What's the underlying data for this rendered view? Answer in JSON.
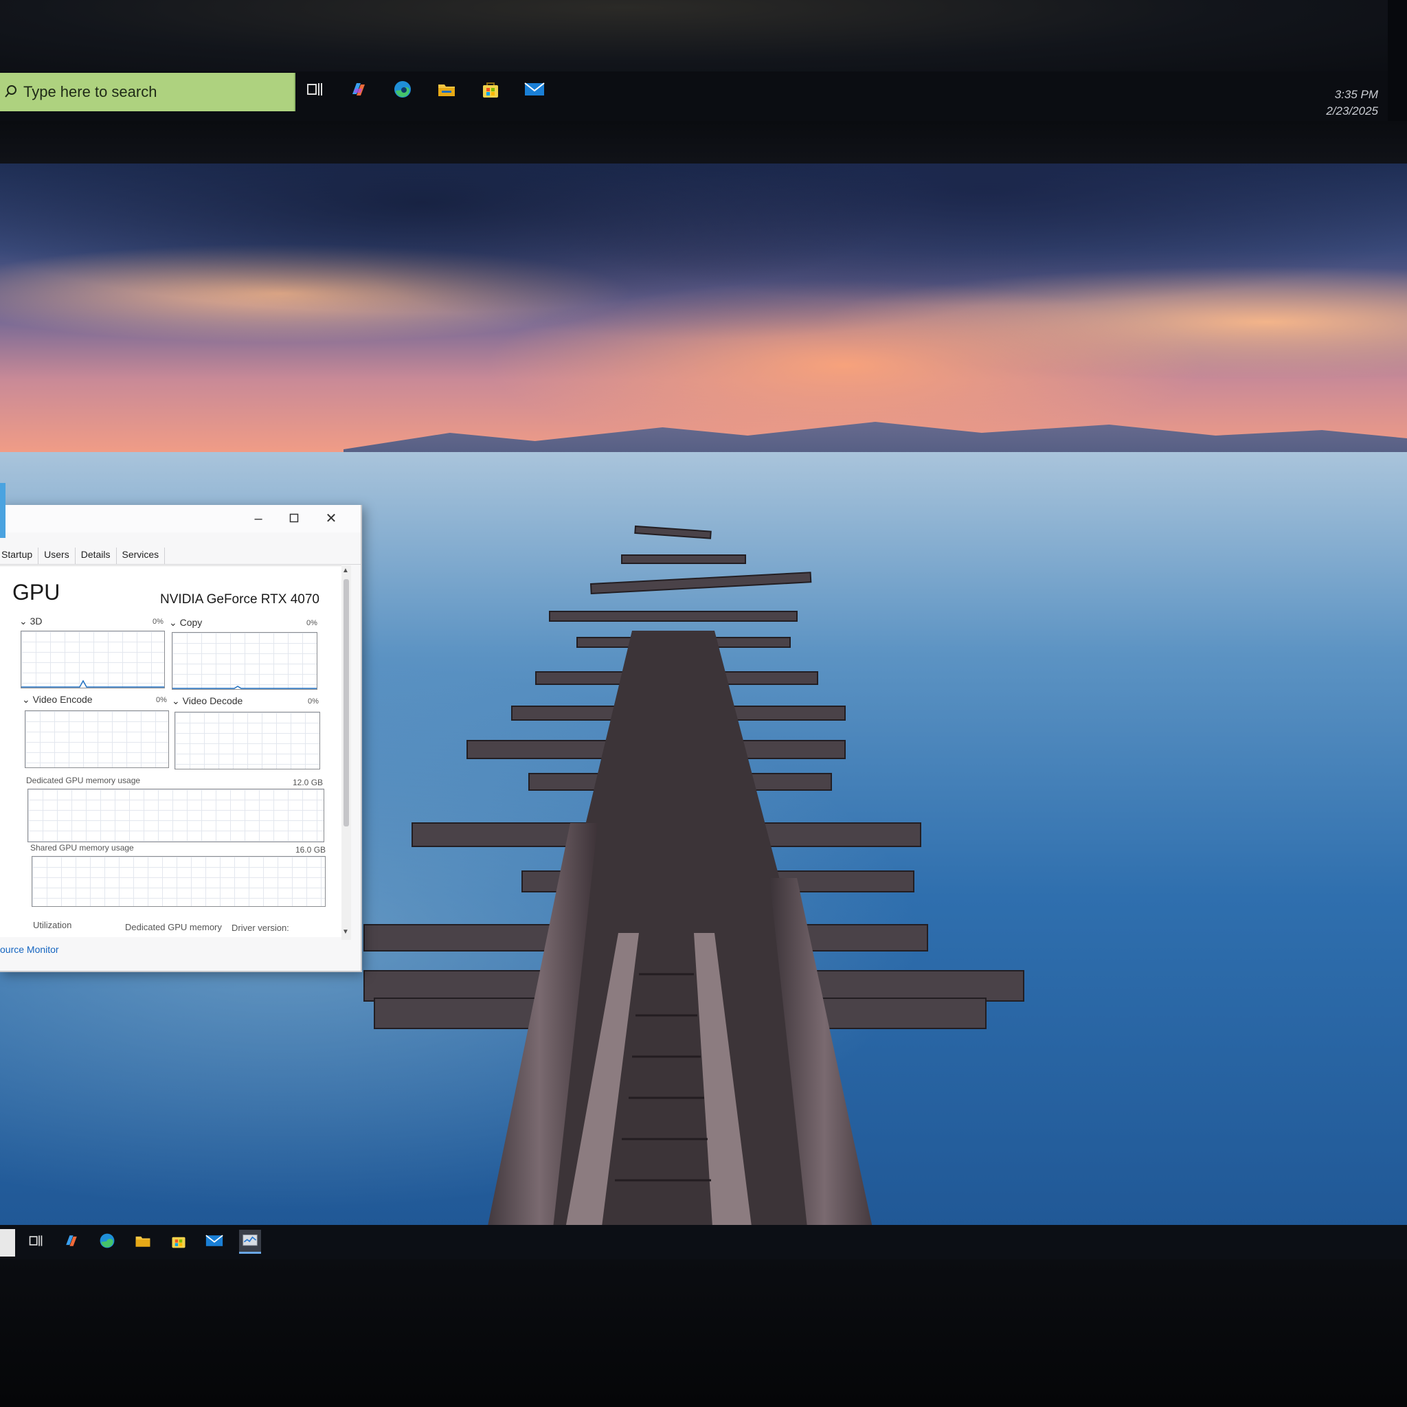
{
  "top_taskbar": {
    "search_placeholder": "Type here to search",
    "icons": [
      "task-view-icon",
      "copilot-icon",
      "edge-icon",
      "file-explorer-icon",
      "store-icon",
      "mail-icon"
    ],
    "clock_time": "3:35 PM",
    "clock_date": "2/23/2025"
  },
  "task_manager": {
    "tabs": [
      "Startup",
      "Users",
      "Details",
      "Services"
    ],
    "title": "GPU",
    "gpu_model": "NVIDIA GeForce RTX 4070",
    "engines": [
      {
        "label": "3D",
        "pct": "0%"
      },
      {
        "label": "Copy",
        "pct": "0%"
      },
      {
        "label": "Video Encode",
        "pct": "0%"
      },
      {
        "label": "Video Decode",
        "pct": "0%"
      }
    ],
    "dedicated_label": "Dedicated GPU memory usage",
    "dedicated_max": "12.0 GB",
    "shared_label": "Shared GPU memory usage",
    "shared_max": "16.0 GB",
    "footer": {
      "utilization": "Utilization",
      "dedicated_memory": "Dedicated GPU memory",
      "driver_version": "Driver version:"
    },
    "resource_monitor_link": "ource Monitor"
  },
  "bottom_taskbar": {
    "icons": [
      "task-view-icon",
      "copilot-icon",
      "edge-icon",
      "file-explorer-icon",
      "store-icon",
      "mail-icon",
      "task-manager-icon"
    ]
  },
  "colors": {
    "search_bg": "#aed27f",
    "accent_link": "#1565c0",
    "active_task_underline": "#6aa7e6"
  }
}
